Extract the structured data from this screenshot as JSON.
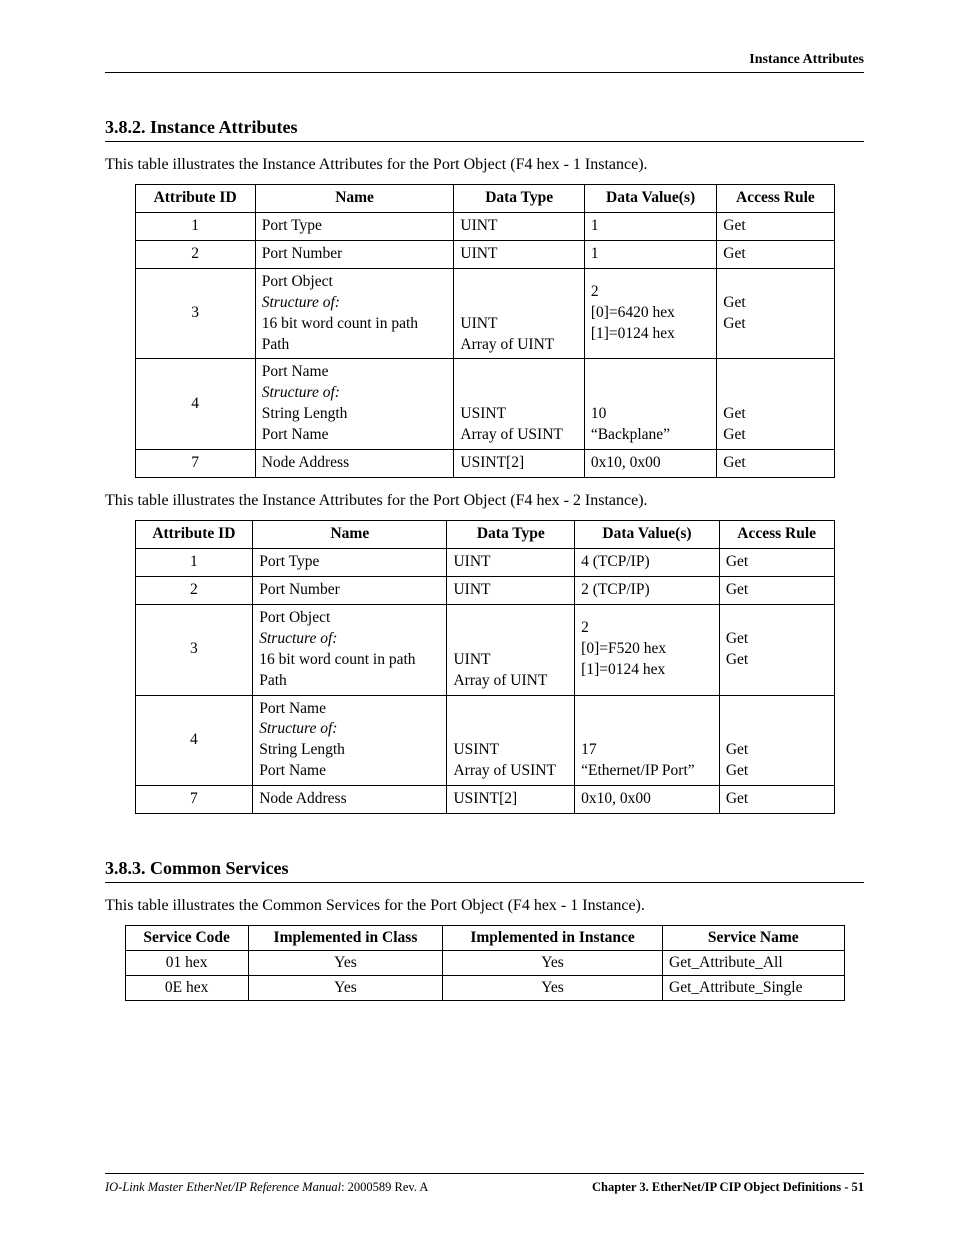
{
  "header": {
    "running": "Instance Attributes"
  },
  "sections": {
    "s382": {
      "title": "3.8.2.  Instance Attributes"
    },
    "s383": {
      "title": "3.8.3.  Common Services"
    }
  },
  "intro": {
    "t1": "This table illustrates the Instance Attributes for the Port Object (F4 hex - 1 Instance).",
    "t2": "This table illustrates the Instance Attributes for the Port Object (F4 hex - 2 Instance).",
    "t3": "This table illustrates the Common Services for the Port Object (F4 hex - 1 Instance)."
  },
  "columns_attr": [
    "Attribute ID",
    "Name",
    "Data Type",
    "Data Value(s)",
    "Access Rule"
  ],
  "columns_svc": [
    "Service Code",
    "Implemented in Class",
    "Implemented in Instance",
    "Service Name"
  ],
  "chart_data": [
    {
      "type": "table",
      "title": "Instance Attributes (F4 hex - 1 Instance)",
      "rows": [
        {
          "id": "1",
          "name": "Port Type",
          "dtype": "UINT",
          "value": "1",
          "rule": "Get"
        },
        {
          "id": "2",
          "name": "Port Number",
          "dtype": "UINT",
          "value": "1",
          "rule": "Get"
        },
        {
          "id": "3",
          "name_lines": [
            "Port Object",
            "Structure of:",
            "16 bit word count in path",
            "Path"
          ],
          "name_em_idx": 1,
          "dtype_lines": [
            "UINT",
            "Array of UINT"
          ],
          "value_lines": [
            "2",
            "[0]=6420 hex",
            "[1]=0124 hex"
          ],
          "rule_lines": [
            "Get",
            "Get"
          ]
        },
        {
          "id": "4",
          "name_lines": [
            "Port Name",
            "Structure of:",
            "String Length",
            "Port Name"
          ],
          "name_em_idx": 1,
          "dtype_lines": [
            "USINT",
            "Array of USINT"
          ],
          "value_lines": [
            "10",
            "“Backplane”"
          ],
          "rule_lines": [
            "Get",
            "Get"
          ]
        },
        {
          "id": "7",
          "name": "Node Address",
          "dtype": "USINT[2]",
          "value": "0x10, 0x00",
          "rule": "Get"
        }
      ]
    },
    {
      "type": "table",
      "title": "Instance Attributes (F4 hex - 2 Instance)",
      "rows": [
        {
          "id": "1",
          "name": "Port Type",
          "dtype": "UINT",
          "value": "4 (TCP/IP)",
          "rule": "Get"
        },
        {
          "id": "2",
          "name": "Port Number",
          "dtype": "UINT",
          "value": "2 (TCP/IP)",
          "rule": "Get"
        },
        {
          "id": "3",
          "name_lines": [
            "Port Object",
            "Structure of:",
            "16 bit word count in path",
            "Path"
          ],
          "name_em_idx": 1,
          "dtype_lines": [
            "UINT",
            "Array of UINT"
          ],
          "value_lines": [
            "2",
            "[0]=F520 hex",
            "[1]=0124 hex"
          ],
          "rule_lines": [
            "Get",
            "Get"
          ]
        },
        {
          "id": "4",
          "name_lines": [
            "Port Name",
            "Structure of:",
            "String Length",
            "Port Name"
          ],
          "name_em_idx": 1,
          "dtype_lines": [
            "USINT",
            "Array of USINT"
          ],
          "value_lines": [
            "17",
            "“Ethernet/IP Port”"
          ],
          "rule_lines": [
            "Get",
            "Get"
          ]
        },
        {
          "id": "7",
          "name": "Node Address",
          "dtype": "USINT[2]",
          "value": "0x10, 0x00",
          "rule": "Get"
        }
      ]
    },
    {
      "type": "table",
      "title": "Common Services (F4 hex - 1 Instance)",
      "rows": [
        {
          "code": "01 hex",
          "in_class": "Yes",
          "in_instance": "Yes",
          "name": "Get_Attribute_All"
        },
        {
          "code": "0E hex",
          "in_class": "Yes",
          "in_instance": "Yes",
          "name": "Get_Attribute_Single"
        }
      ]
    }
  ],
  "footer": {
    "left_title": "IO-Link Master EtherNet/IP Reference Manual",
    "left_rev": ": 2000589 Rev. A",
    "right_chapter": "Chapter 3. EtherNet/IP CIP Object Definitions",
    "right_page": "  - 51"
  }
}
